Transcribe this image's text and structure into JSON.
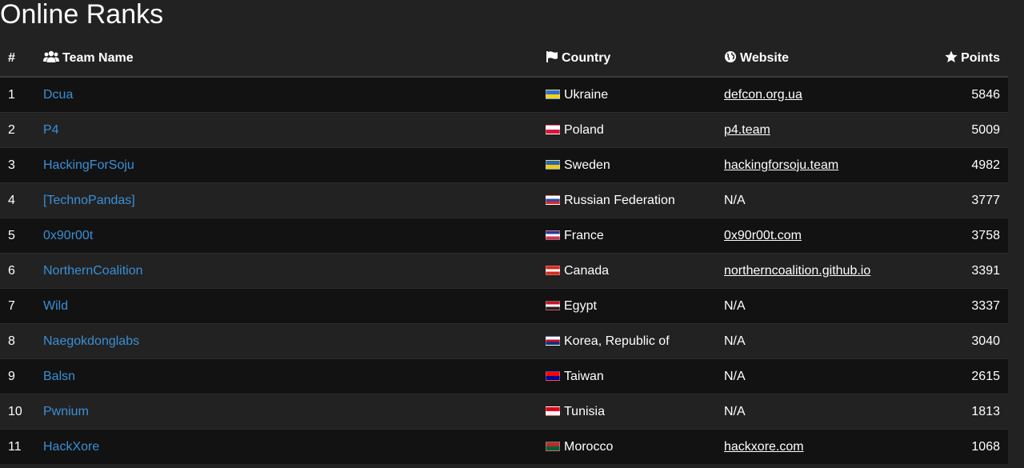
{
  "page": {
    "title": "Online Ranks"
  },
  "table": {
    "headers": {
      "rank": "#",
      "team": "Team Name",
      "country": "Country",
      "website": "Website",
      "points": "Points"
    },
    "header_icons": {
      "team": "users-icon",
      "country": "flag-icon",
      "website": "globe-icon",
      "points": "star-icon"
    },
    "rows": [
      {
        "rank": "1",
        "team": "Dcua",
        "country": "Ukraine",
        "website": "defcon.org.ua",
        "points": "5846",
        "flag_colors": [
          "#2f6fd1",
          "#f2d21b"
        ]
      },
      {
        "rank": "2",
        "team": "P4",
        "country": "Poland",
        "website": "p4.team",
        "points": "5009",
        "flag_colors": [
          "#ffffff",
          "#dc143c"
        ]
      },
      {
        "rank": "3",
        "team": "HackingForSoju",
        "country": "Sweden",
        "website": "hackingforsoju.team",
        "points": "4982",
        "flag_colors": [
          "#2566b5",
          "#f2c912"
        ]
      },
      {
        "rank": "4",
        "team": "[TechnoPandas]",
        "country": "Russian Federation",
        "website": "N/A",
        "points": "3777",
        "flag_colors": [
          "#ffffff",
          "#1c4fc4",
          "#d52b1e"
        ]
      },
      {
        "rank": "5",
        "team": "0x90r00t",
        "country": "France",
        "website": "0x90r00t.com",
        "points": "3758",
        "flag_colors": [
          "#1f3d9a",
          "#ffffff",
          "#e0323a"
        ]
      },
      {
        "rank": "6",
        "team": "NorthernCoalition",
        "country": "Canada",
        "website": "northerncoalition.github.io",
        "points": "3391",
        "flag_colors": [
          "#d52b1e",
          "#ffffff",
          "#d52b1e"
        ]
      },
      {
        "rank": "7",
        "team": "Wild",
        "country": "Egypt",
        "website": "N/A",
        "points": "3337",
        "flag_colors": [
          "#ce1126",
          "#ffffff",
          "#222222"
        ]
      },
      {
        "rank": "8",
        "team": "Naegokdonglabs",
        "country": "Korea, Republic of",
        "website": "N/A",
        "points": "3040",
        "flag_colors": [
          "#ffffff",
          "#c60c30",
          "#003478"
        ]
      },
      {
        "rank": "9",
        "team": "Balsn",
        "country": "Taiwan",
        "website": "N/A",
        "points": "2615",
        "flag_colors": [
          "#fe0000",
          "#000095"
        ]
      },
      {
        "rank": "10",
        "team": "Pwnium",
        "country": "Tunisia",
        "website": "N/A",
        "points": "1813",
        "flag_colors": [
          "#e70013",
          "#ffffff"
        ]
      },
      {
        "rank": "11",
        "team": "HackXore",
        "country": "Morocco",
        "website": "hackxore.com",
        "points": "1068",
        "flag_colors": [
          "#c1272d",
          "#006233"
        ]
      }
    ]
  },
  "colors": {
    "background": "#222222",
    "row_dark": "#121212",
    "team_link": "#3a8fd6",
    "text": "#ffffff"
  }
}
